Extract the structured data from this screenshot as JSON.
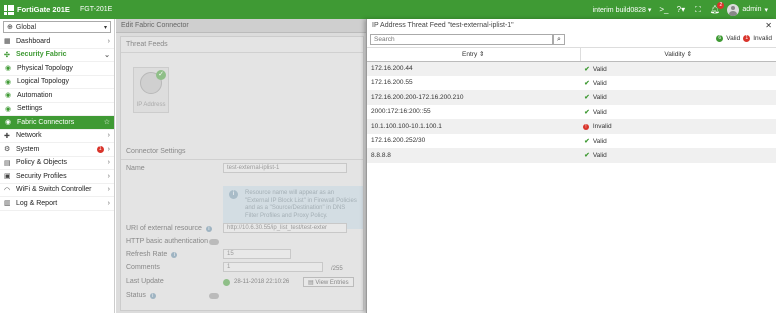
{
  "topbar": {
    "product": "FortiGate 201E",
    "hostname": "FGT-201E",
    "build": "interim build0828",
    "notification_count": "2",
    "user": "admin"
  },
  "sidebar": {
    "vdom": "Global",
    "items": [
      {
        "label": "Dashboard"
      },
      {
        "label": "Security Fabric"
      },
      {
        "label": "Physical Topology"
      },
      {
        "label": "Logical Topology"
      },
      {
        "label": "Automation"
      },
      {
        "label": "Settings"
      },
      {
        "label": "Fabric Connectors"
      },
      {
        "label": "Network"
      },
      {
        "label": "System",
        "badge": "1"
      },
      {
        "label": "Policy & Objects"
      },
      {
        "label": "Security Profiles"
      },
      {
        "label": "WiFi & Switch Controller"
      },
      {
        "label": "Log & Report"
      }
    ]
  },
  "background_page": {
    "header": "Edit Fabric Connector",
    "threat_feeds": "Threat Feeds",
    "tile_caption": "IP Address",
    "connector_settings": "Connector Settings",
    "name_label": "Name",
    "name_value": "test-external-iplist-1",
    "info_text": "Resource name will appear as an \"External IP Block List\" in Firewall Policies and as a \"Source/Destination\" in DNS Filter Profiles and Proxy Policy.",
    "uri_label": "URI of external resource",
    "uri_value": "http://10.6.30.55/ip_list_test/test-exter",
    "http_auth_label": "HTTP basic authentication",
    "refresh_label": "Refresh Rate",
    "refresh_value": "15",
    "comments_label": "Comments",
    "comments_value": "1",
    "comments_count": "/255",
    "last_update_label": "Last Update",
    "last_update_value": "28-11-2018 22:10:26",
    "view_entries": "View Entries",
    "status_label": "Status"
  },
  "panel": {
    "title": "IP Address Threat Feed \"test-external-iplist-1\"",
    "search_placeholder": "Search",
    "valid_count": "6",
    "valid_label": "Valid",
    "invalid_count": "1",
    "invalid_label": "Invalid",
    "col_entry": "Entry",
    "col_validity": "Validity",
    "rows": [
      {
        "entry": "172.16.200.44",
        "validity": "Valid"
      },
      {
        "entry": "172.16.200.55",
        "validity": "Valid"
      },
      {
        "entry": "172.16.200.200-172.16.200.210",
        "validity": "Valid"
      },
      {
        "entry": "2000:172:16:200::55",
        "validity": "Valid"
      },
      {
        "entry": "10.1.100.100-10.1.100.1",
        "validity": "Invalid"
      },
      {
        "entry": "172.16.200.252/30",
        "validity": "Valid"
      },
      {
        "entry": "8.8.8.8",
        "validity": "Valid"
      }
    ]
  },
  "colors": {
    "brand": "#3f9a34",
    "error": "#d9342b"
  }
}
